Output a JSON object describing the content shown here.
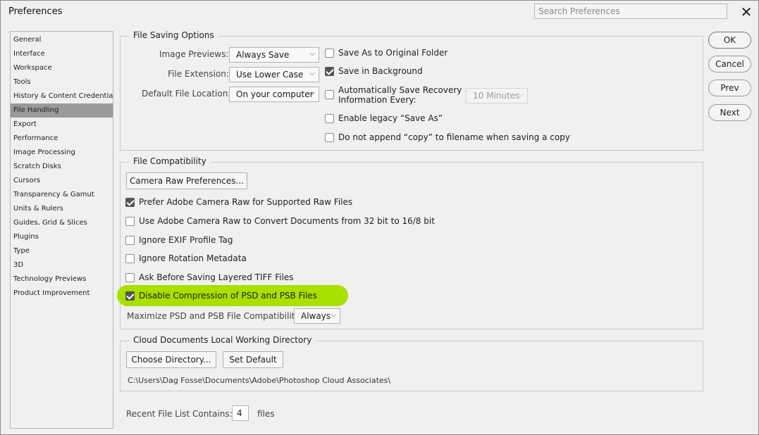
{
  "window": {
    "title": "Preferences",
    "search_placeholder": "Search Preferences",
    "close_glyph": "✕"
  },
  "sidebar": {
    "items": [
      {
        "label": "General"
      },
      {
        "label": "Interface"
      },
      {
        "label": "Workspace"
      },
      {
        "label": "Tools"
      },
      {
        "label": "History & Content Credentials"
      },
      {
        "label": "File Handling",
        "selected": true
      },
      {
        "label": "Export"
      },
      {
        "label": "Performance"
      },
      {
        "label": "Image Processing"
      },
      {
        "label": "Scratch Disks"
      },
      {
        "label": "Cursors"
      },
      {
        "label": "Transparency & Gamut"
      },
      {
        "label": "Units & Rulers"
      },
      {
        "label": "Guides, Grid & Slices"
      },
      {
        "label": "Plugins"
      },
      {
        "label": "Type"
      },
      {
        "label": "3D"
      },
      {
        "label": "Technology Previews"
      },
      {
        "label": "Product Improvement"
      }
    ]
  },
  "file_saving": {
    "title": "File Saving Options",
    "image_previews_label": "Image Previews:",
    "image_previews_value": "Always Save",
    "file_extension_label": "File Extension:",
    "file_extension_value": "Use Lower Case",
    "default_location_label": "Default File Location:",
    "default_location_value": "On your computer",
    "save_original_folder": {
      "label": "Save As to Original Folder",
      "checked": false
    },
    "save_background": {
      "label": "Save in Background",
      "checked": true
    },
    "auto_save": {
      "label_line1": "Automatically Save Recovery",
      "label_line2": "Information Every:",
      "checked": false
    },
    "auto_save_interval": "10 Minutes",
    "legacy_save_as": {
      "label": "Enable legacy “Save As”",
      "checked": false
    },
    "no_copy_append": {
      "label": "Do not append “copy” to filename when saving a copy",
      "checked": false
    }
  },
  "file_compat": {
    "title": "File Compatibility",
    "camera_raw_button": "Camera Raw Preferences...",
    "prefer_acr": {
      "label": "Prefer Adobe Camera Raw for Supported Raw Files",
      "checked": true
    },
    "use_acr_convert": {
      "label": "Use Adobe Camera Raw to Convert Documents from 32 bit to 16/8 bit",
      "checked": false
    },
    "ignore_exif": {
      "label": "Ignore EXIF Profile Tag",
      "checked": false
    },
    "ignore_rotation": {
      "label": "Ignore Rotation Metadata",
      "checked": false
    },
    "ask_tiff": {
      "label": "Ask Before Saving Layered TIFF Files",
      "checked": false
    },
    "disable_compression": {
      "label": "Disable Compression of PSD and PSB Files",
      "checked": true
    },
    "maximize_label": "Maximize PSD and PSB File Compatibility:",
    "maximize_value": "Always",
    "highlight_color": "#a8e000"
  },
  "cloud_docs": {
    "title": "Cloud Documents Local Working Directory",
    "choose_button": "Choose Directory...",
    "default_button": "Set Default",
    "path": "C:\\Users\\Dag Fosse\\Documents\\Adobe\\Photoshop Cloud Associates\\"
  },
  "recent_files": {
    "label": "Recent File List Contains:",
    "value": "4",
    "suffix": "files"
  },
  "buttons": {
    "ok": "OK",
    "cancel": "Cancel",
    "prev": "Prev",
    "next": "Next"
  }
}
